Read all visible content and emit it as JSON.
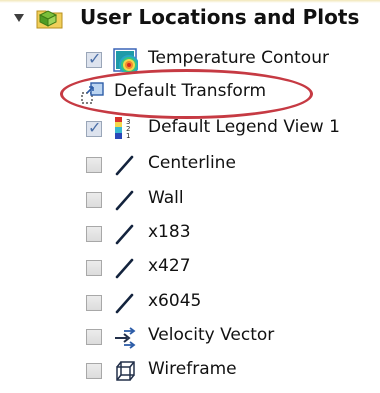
{
  "tree": {
    "root": {
      "label": "User Locations and Plots",
      "icon": "user-locations-folder-icon"
    },
    "items": [
      {
        "label": "Temperature Contour",
        "checked": true,
        "icon": "contour-icon"
      },
      {
        "label": "Default Transform",
        "checked": null,
        "icon": "transform-icon"
      },
      {
        "label": "Default Legend View 1",
        "checked": true,
        "icon": "legend-icon"
      },
      {
        "label": "Centerline",
        "checked": false,
        "icon": "line-icon"
      },
      {
        "label": "Wall",
        "checked": false,
        "icon": "line-icon"
      },
      {
        "label": "x183",
        "checked": false,
        "icon": "line-icon"
      },
      {
        "label": "x427",
        "checked": false,
        "icon": "line-icon"
      },
      {
        "label": "x6045",
        "checked": false,
        "icon": "line-icon"
      },
      {
        "label": "Velocity Vector",
        "checked": false,
        "icon": "vector-icon"
      },
      {
        "label": "Wireframe",
        "checked": false,
        "icon": "wireframe-icon"
      }
    ]
  },
  "annotation": {
    "highlight_color": "#c63a43"
  }
}
